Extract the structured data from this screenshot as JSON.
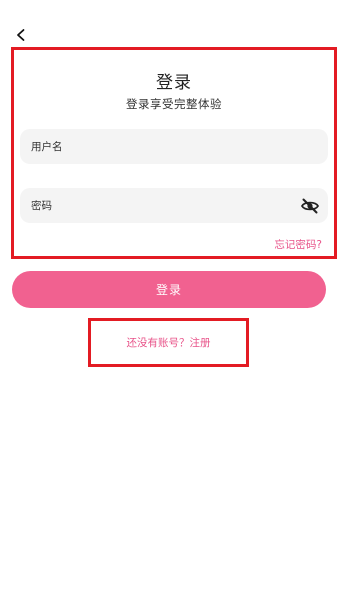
{
  "header": {
    "back_icon": "chevron-left-icon"
  },
  "login": {
    "title": "登录",
    "subtitle": "登录享受完整体验",
    "username_placeholder": "用户名",
    "password_placeholder": "密码",
    "visibility_icon": "eye-off-icon",
    "forgot_password": "忘记密码?",
    "submit_label": "登录"
  },
  "register": {
    "link_text": "还没有账号？注册"
  },
  "colors": {
    "accent": "#f16190",
    "link": "#e8548a",
    "highlight_border": "#e31b23",
    "input_bg": "#f4f4f4"
  }
}
